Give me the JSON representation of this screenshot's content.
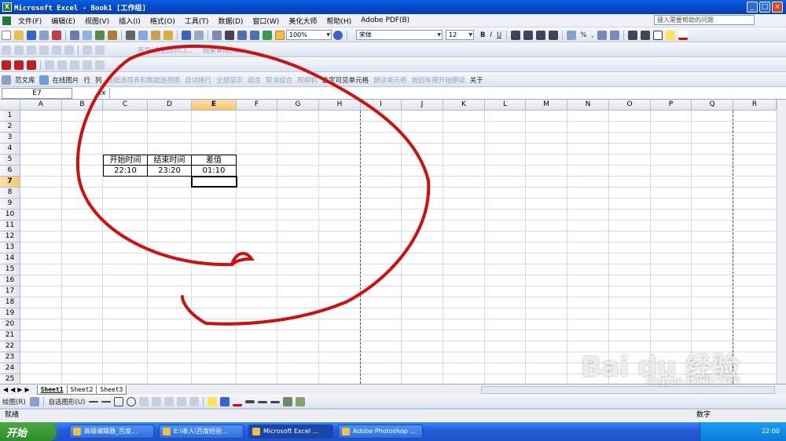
{
  "window": {
    "title": "Microsoft Excel - Book1  [工作组]",
    "min": "_",
    "max": "□",
    "close": "×"
  },
  "menu": {
    "items": [
      "文件(F)",
      "编辑(E)",
      "视图(V)",
      "插入(I)",
      "格式(O)",
      "工具(T)",
      "数据(D)",
      "窗口(W)",
      "美化大师",
      "帮助(H)",
      "Adobe PDF(B)"
    ],
    "help_placeholder": "键入需要帮助的问题"
  },
  "toolbar": {
    "zoom": "100%",
    "font": "宋体",
    "size": "12",
    "bold": "B",
    "italic": "I",
    "underline": "U",
    "percent": "%",
    "comma": ","
  },
  "toolbar2": {
    "items": [
      "范文库",
      "在线图片",
      "行",
      "列",
      "数据透视表和数据透视图",
      "自动换行",
      "全部显示",
      "组合",
      "取消组合",
      "照相机",
      "选定可见单元格",
      "朗读单元格",
      "按回车键开始朗读",
      "关于"
    ]
  },
  "toolbar3": {
    "items": [
      "答复(含更改)(C)...",
      "结束审阅(N)..."
    ]
  },
  "formula": {
    "namebox": "E7",
    "fx": "fx",
    "value": ""
  },
  "grid": {
    "columns": [
      "A",
      "B",
      "C",
      "D",
      "E",
      "F",
      "G",
      "H",
      "I",
      "J",
      "K",
      "L",
      "M",
      "N",
      "O",
      "P",
      "Q",
      "R"
    ],
    "selected_column": "E",
    "selected_row": "7",
    "rows": [
      "1",
      "2",
      "3",
      "4",
      "5",
      "6",
      "7",
      "8",
      "9",
      "10",
      "11",
      "12",
      "13",
      "14",
      "15",
      "16",
      "17",
      "18",
      "19",
      "20",
      "21",
      "22",
      "23",
      "24",
      "25"
    ],
    "table": {
      "h_start": "开始时间",
      "h_end": "结束时间",
      "h_diff": "差值",
      "v_start": "22:10",
      "v_end": "23:20",
      "v_diff": "01:10"
    }
  },
  "sheets": [
    "Sheet1",
    "Sheet2",
    "Sheet3"
  ],
  "drawbar": {
    "draw": "绘图(R)",
    "autoshapes": "自选图形(U)"
  },
  "status": {
    "text": "就绪",
    "mode": "数字"
  },
  "taskbar": {
    "start": "开始",
    "tasks": [
      "高级编辑器_百度...",
      "E:\\收入\\百度经验...",
      "Microsoft Excel ...",
      "Adobe Photoshop ..."
    ],
    "clock": "22:00"
  },
  "watermark": {
    "brand": "Bai du 经验",
    "url": "jingyan.baidu.com"
  },
  "annotation": {
    "color": "#d01010"
  }
}
